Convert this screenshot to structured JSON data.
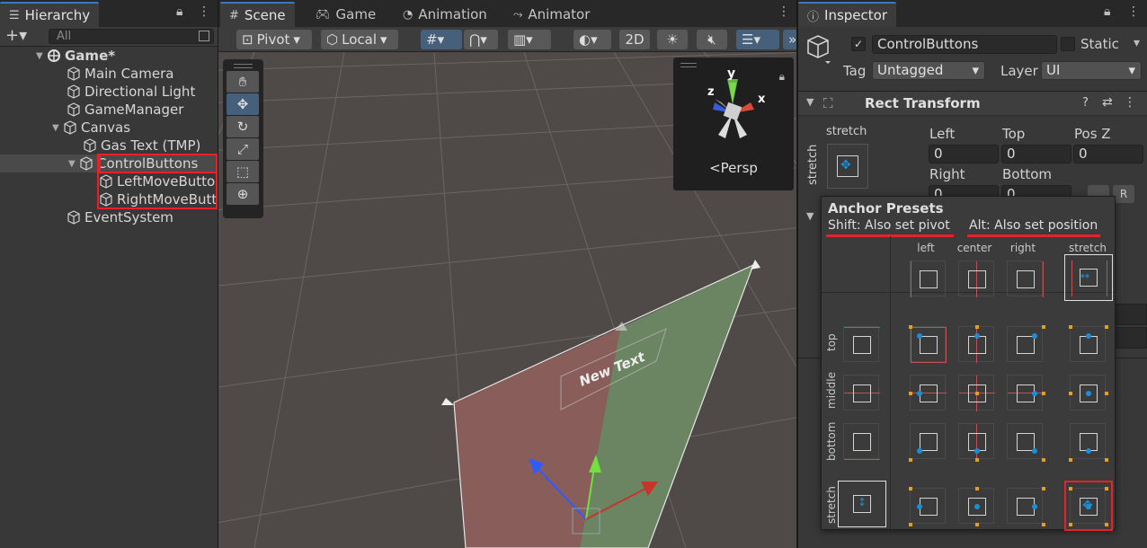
{
  "hierarchy": {
    "tab_label": "Hierarchy",
    "search_placeholder": "All",
    "items": [
      {
        "label": "Game*",
        "depth": 0
      },
      {
        "label": "Main Camera",
        "depth": 1
      },
      {
        "label": "Directional Light",
        "depth": 1
      },
      {
        "label": "GameManager",
        "depth": 1
      },
      {
        "label": "Canvas",
        "depth": 1
      },
      {
        "label": "Gas Text (TMP)",
        "depth": 2
      },
      {
        "label": "ControlButtons",
        "depth": 2
      },
      {
        "label": "LeftMoveButto",
        "depth": 3
      },
      {
        "label": "RightMoveButt",
        "depth": 3
      },
      {
        "label": "EventSystem",
        "depth": 1
      }
    ]
  },
  "scene": {
    "tabs": [
      "Scene",
      "Game",
      "Animation",
      "Animator"
    ],
    "toolbar": {
      "pivot": "Pivot",
      "local": "Local",
      "mode_2d": "2D"
    },
    "gizmo_label": "<Persp",
    "axis_y": "y",
    "axis_x": "x",
    "axis_z": "z",
    "canvas_text": "New Text"
  },
  "inspector": {
    "tab_label": "Inspector",
    "object_name": "ControlButtons",
    "static_label": "Static",
    "tag_label": "Tag",
    "tag_value": "Untagged",
    "layer_label": "Layer",
    "layer_value": "UI",
    "component_title": "Rect Transform",
    "stretch_label": "stretch",
    "fields": {
      "left_label": "Left",
      "left_value": "0",
      "top_label": "Top",
      "top_value": "0",
      "posz_label": "Pos Z",
      "posz_value": "0",
      "right_label": "Right",
      "right_value": "0",
      "bottom_label": "Bottom",
      "bottom_value": "0"
    }
  },
  "anchor_presets": {
    "title": "Anchor Presets",
    "shift_hint": "Shift: Also set pivot",
    "alt_hint": "Alt: Also set position",
    "columns": [
      "left",
      "center",
      "right",
      "stretch"
    ],
    "rows": [
      "top",
      "middle",
      "bottom",
      "stretch"
    ]
  },
  "colors": {
    "highlight_red": "#e8202a",
    "accent_blue": "#3a79bb",
    "anchor_blue": "#1a8fd8",
    "anchor_orange": "#e1a11e"
  }
}
